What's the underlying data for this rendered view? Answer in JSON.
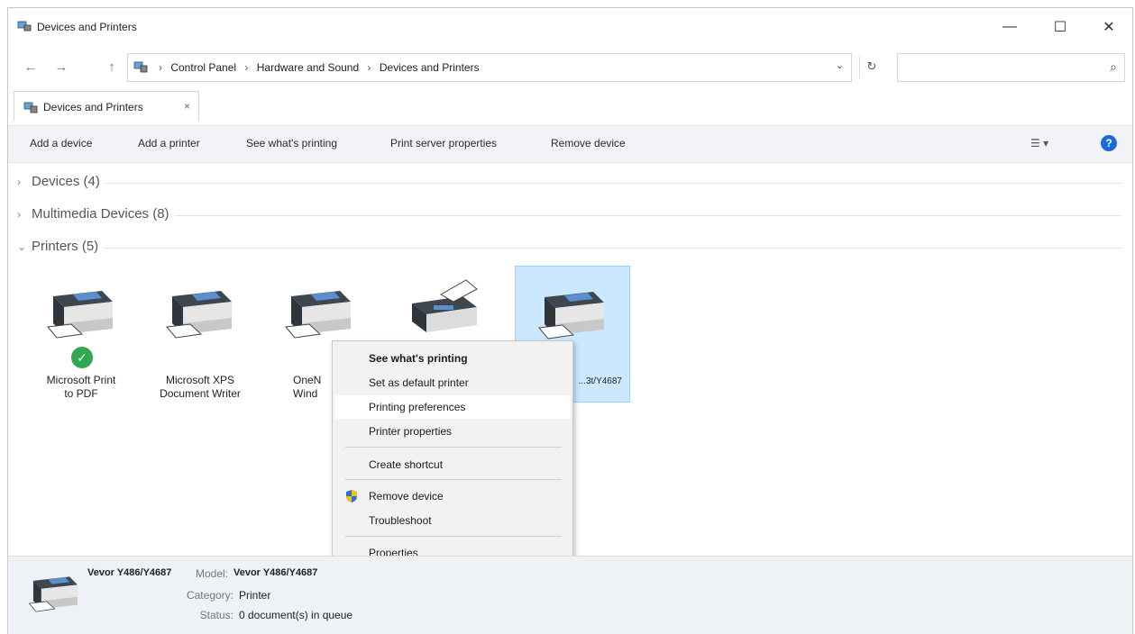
{
  "window": {
    "title": "Devices and Printers",
    "controls": {
      "minimize": "—",
      "maximize": "☐",
      "close": "✕"
    }
  },
  "nav": {
    "back": "←",
    "forward": "→",
    "up": "↑",
    "breadcrumb": [
      "Control Panel",
      "Hardware and Sound",
      "Devices and Printers"
    ],
    "dropdown": "⌄",
    "refresh": "↻",
    "search_placeholder": "",
    "search_icon": "⌕"
  },
  "tab": {
    "label": "Devices and Printers",
    "close": "×"
  },
  "toolbar": {
    "items": [
      "Add a device",
      "Add a printer",
      "See what's printing",
      "Print server properties",
      "Remove device"
    ],
    "view_icon": "☰ ▾",
    "help": "?"
  },
  "groups": [
    {
      "chevron": "›",
      "label": "Devices (4)"
    },
    {
      "chevron": "›",
      "label": "Multimedia Devices (8)"
    },
    {
      "chevron": "⌄",
      "label": "Printers (5)"
    }
  ],
  "printers": [
    {
      "name_line1": "Microsoft Print",
      "name_line2": "to PDF",
      "default": true,
      "default_mark": "✓"
    },
    {
      "name_line1": "Microsoft XPS",
      "name_line2": "Document Writer",
      "default": false
    },
    {
      "name_line1": "OneN",
      "name_line2": "Wind",
      "default": false
    },
    {
      "name_line1": "",
      "name_line2": "",
      "default": false,
      "kind": "fax"
    },
    {
      "name_line1": "...3t/Y4687",
      "name_line2": "",
      "default": false,
      "selected": true
    }
  ],
  "context_menu": {
    "items": [
      {
        "label": "See what's printing",
        "bold": true
      },
      {
        "label": "Set as default printer"
      },
      {
        "label": "Printing preferences",
        "hover": true
      },
      {
        "label": "Printer properties"
      },
      {
        "label": "Create shortcut"
      },
      {
        "label": "Remove device",
        "icon": "shield-icon"
      },
      {
        "label": "Troubleshoot"
      },
      {
        "label": "Properties"
      }
    ]
  },
  "details": {
    "name": "Vevor Y486/Y4687",
    "model_key": "Model:",
    "model_value": "Vevor Y486/Y4687",
    "category_key": "Category:",
    "category_value": "Printer",
    "status_key": "Status:",
    "status_value": "0 document(s) in queue"
  }
}
